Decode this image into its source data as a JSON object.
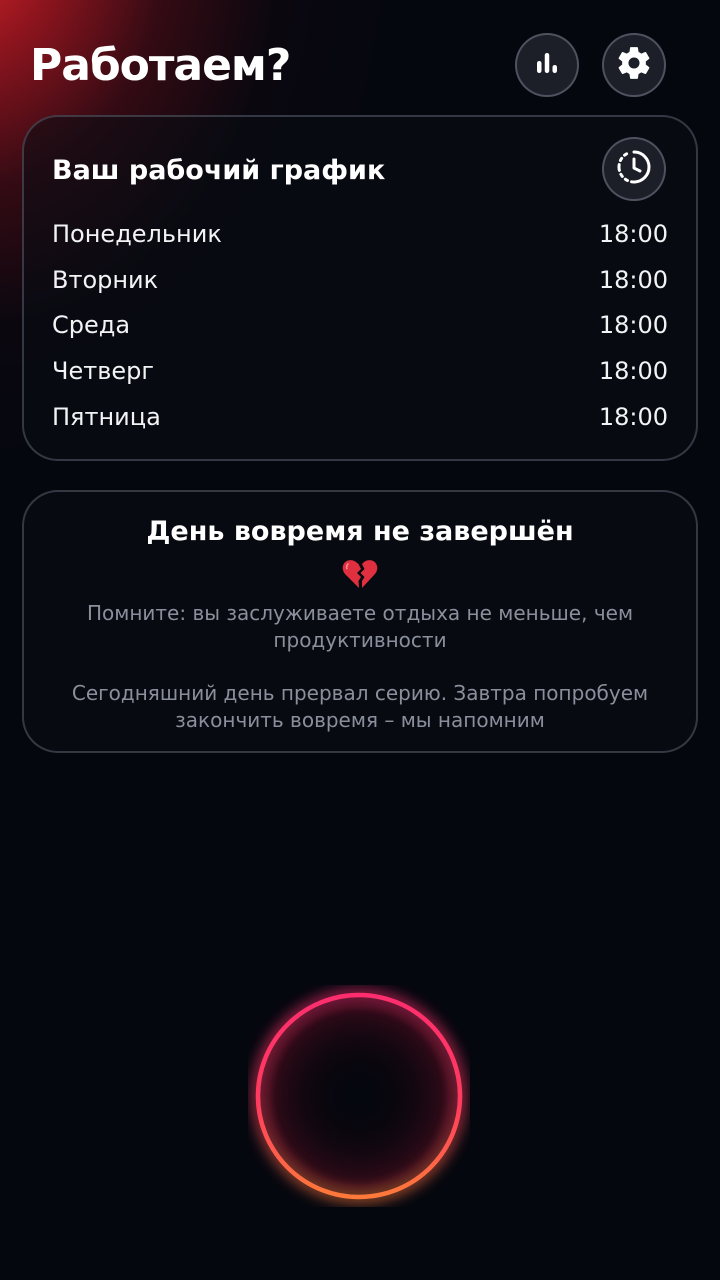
{
  "header": {
    "title": "Работаем?",
    "stats_icon": "bar-chart-icon",
    "settings_icon": "gear-icon"
  },
  "schedule": {
    "title": "Ваш рабочий график",
    "history_icon": "clock-history-icon",
    "days": [
      {
        "day": "Понедельник",
        "time": "18:00"
      },
      {
        "day": "Вторник",
        "time": "18:00"
      },
      {
        "day": "Среда",
        "time": "18:00"
      },
      {
        "day": "Четверг",
        "time": "18:00"
      },
      {
        "day": "Пятница",
        "time": "18:00"
      }
    ]
  },
  "status": {
    "title": "День вовремя не завершён",
    "emoji_icon": "broken-heart-icon",
    "message_1": "Помните: вы заслуживаете отдыха не меньше, чем продуктивности",
    "message_2": "Сегодняшний день прервал серию. Завтра попробуем закончить вовремя – мы напомним"
  },
  "start_button": {
    "icon": "glowing-ring-icon"
  },
  "colors": {
    "background": "#05070f",
    "accent_red": "#e8282d",
    "ring_top": "#ff2d6e",
    "ring_bottom": "#ff7a3a",
    "muted_text": "#8a8f9c"
  }
}
